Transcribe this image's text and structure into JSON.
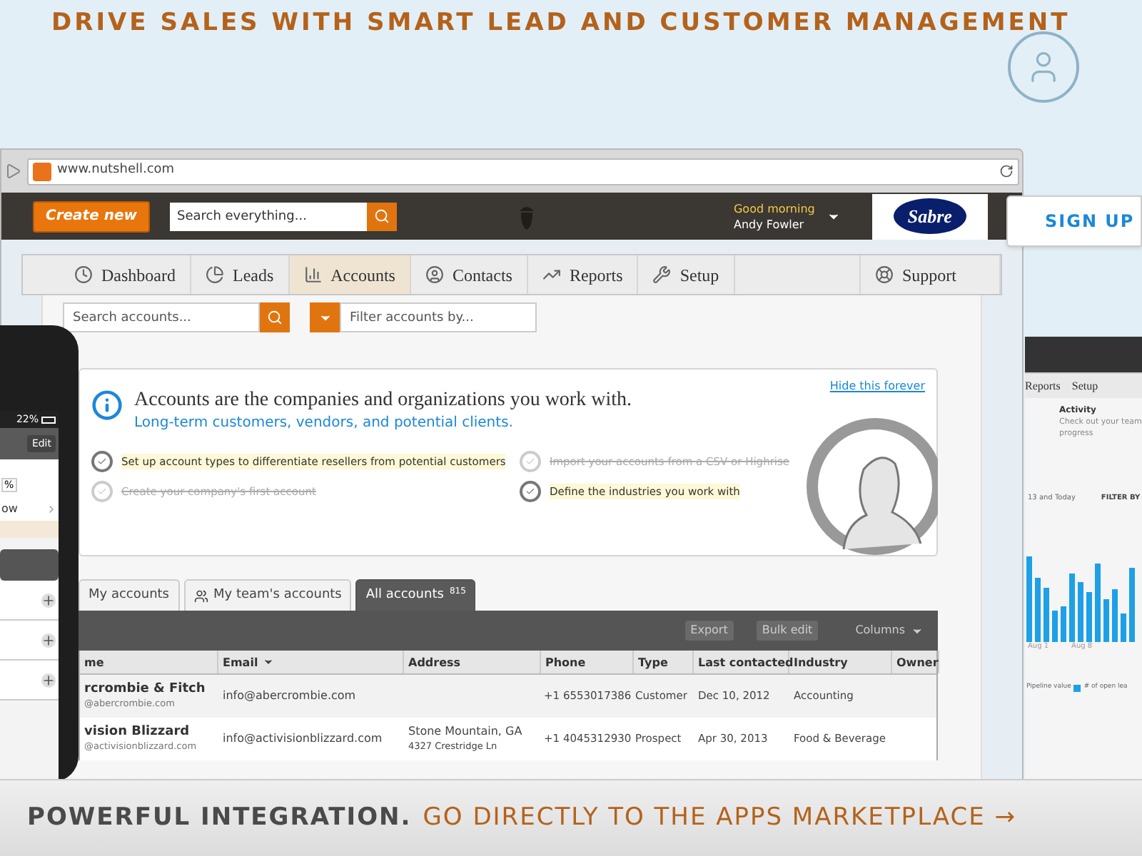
{
  "headline": "DRIVE SALES WITH SMART LEAD AND CUSTOMER MANAGEMENT",
  "browser": {
    "url": "www.nutshell.com",
    "header": {
      "create_button": "Create new",
      "search": {
        "placeholder": "Search everything..."
      },
      "greeting": "Good morning",
      "user": "Andy Fowler",
      "client_logo": "Sabre"
    },
    "nav": [
      {
        "label": "Dashboard",
        "selected": false
      },
      {
        "label": "Leads",
        "selected": false
      },
      {
        "label": "Accounts",
        "selected": true
      },
      {
        "label": "Contacts",
        "selected": false
      },
      {
        "label": "Reports",
        "selected": false
      },
      {
        "label": "Setup",
        "selected": false
      },
      {
        "label": "Support",
        "selected": false
      }
    ],
    "account_search": {
      "placeholder": "Search accounts..."
    },
    "filter": {
      "placeholder": "Filter accounts by..."
    },
    "info": {
      "title": "Accounts are the companies and organizations you work with.",
      "subtitle": "Long-term customers, vendors, and potential clients.",
      "hide_link": "Hide this forever",
      "tasks": [
        {
          "label": "Set up account types to differentiate resellers from potential customers",
          "done": false
        },
        {
          "label": "Import your accounts from a CSV or Highrise",
          "done": true
        },
        {
          "label": "Create your company's first account",
          "done": true
        },
        {
          "label": "Define the industries you work with",
          "done": false
        }
      ]
    },
    "tabs": [
      {
        "label": "My accounts",
        "selected": false
      },
      {
        "label": "My team's accounts",
        "selected": false
      },
      {
        "label": "All accounts",
        "count": "815",
        "selected": true
      }
    ],
    "toolbar": {
      "export": "Export",
      "bulk_edit": "Bulk edit",
      "columns": "Columns"
    },
    "table": {
      "columns": [
        "me",
        "Email",
        "Address",
        "Phone",
        "Type",
        "Last contacted",
        "Industry",
        "Owner"
      ],
      "rows": [
        {
          "name": "rcrombie & Fitch",
          "domain": "@abercrombie.com",
          "email": "info@abercrombie.com",
          "phone": "+1 6553017386",
          "type": "Customer",
          "last_contacted": "Dec 10, 2012",
          "industry": "Accounting"
        },
        {
          "name": "vision Blizzard",
          "domain": "@activisionblizzard.com",
          "email": "info@activisionblizzard.com",
          "address": "Stone Mountain, GA",
          "address_line2": "4327 Crestridge Ln",
          "phone": "+1 4045312930",
          "type": "Prospect",
          "last_contacted": "Apr 30, 2013",
          "industry": "Food & Beverage"
        }
      ]
    }
  },
  "signup_button": "SIGN UP",
  "phone": {
    "battery": "22%",
    "edit_button": "Edit",
    "chip": "%",
    "row_label": "ow"
  },
  "side_panel": {
    "tabs": [
      "Reports",
      "Setup"
    ],
    "activity_title": "Activity",
    "activity_lines": [
      "Check out your team",
      "progress"
    ],
    "date_range": "13 and Today",
    "filter_label": "FILTER BY",
    "axis_labels": [
      "Aug 1",
      "Aug 8"
    ],
    "legend": [
      "Pipeline value",
      "# of open lea"
    ]
  },
  "banner": {
    "lead": "POWERFUL INTEGRATION.",
    "link": "GO DIRECTLY TO THE APPS MARKETPLACE →"
  }
}
